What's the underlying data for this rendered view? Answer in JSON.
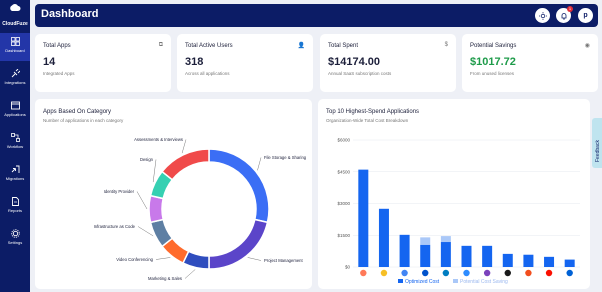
{
  "app": {
    "logo_text": "CloudFuze",
    "page_title": "Dashboard",
    "avatar_initial": "p",
    "notification_count": "1"
  },
  "sidebar": {
    "items": [
      {
        "label": "Dashboard",
        "icon": "grid-icon",
        "active": true
      },
      {
        "label": "Integrations",
        "icon": "plug-icon"
      },
      {
        "label": "Applications",
        "icon": "window-icon"
      },
      {
        "label": "Workflow",
        "icon": "workflow-icon"
      },
      {
        "label": "Migrations",
        "icon": "migrate-icon"
      },
      {
        "label": "Reports",
        "icon": "document-icon"
      },
      {
        "label": "Settings",
        "icon": "gear-icon"
      }
    ]
  },
  "stats": [
    {
      "label": "Total Apps",
      "value": "14",
      "sub": "Integrated Apps",
      "icon": "apps-icon"
    },
    {
      "label": "Total Active Users",
      "value": "318",
      "sub": "Across all applications",
      "icon": "users-icon"
    },
    {
      "label": "Total Spent",
      "value": "$14174.00",
      "sub": "Annual SaaS subscription costs",
      "icon": "dollar-icon"
    },
    {
      "label": "Potential Savings",
      "value": "$1017.72",
      "sub": "From unused licenses",
      "icon": "piggy-icon",
      "accent": "#1e9b4a"
    }
  ],
  "category_panel": {
    "title": "Apps Based On Category",
    "subtitle": "Number of applications in each category"
  },
  "spend_panel": {
    "title": "Top 10 Highest-Spend Applications",
    "subtitle": "Organization-Wide Total Cost Breakdown"
  },
  "feedback_label": "Feedback",
  "chart_data": [
    {
      "type": "pie",
      "title": "Apps Based On Category",
      "categories": [
        "File Storage & Sharing",
        "Project Management",
        "Marketing & Sales",
        "Video Conferencing",
        "Infrastructure as Code",
        "Identity Provider",
        "Design",
        "Assessments & Interviews"
      ],
      "values": [
        4,
        3,
        1,
        1,
        1,
        1,
        1,
        2
      ],
      "colors": [
        "#3b6ef5",
        "#5b45c9",
        "#2f4dbe",
        "#ff6b2c",
        "#5e7fa3",
        "#c879ea",
        "#36d0b2",
        "#f04a4a"
      ]
    },
    {
      "type": "bar",
      "title": "Top 10 Highest-Spend Applications",
      "ylim": [
        0,
        6000
      ],
      "yticks": [
        "$0",
        "$1500",
        "$3000",
        "$4500",
        "$6000"
      ],
      "categories": [
        "HubSpot",
        "Monday.com",
        "Google Workspace",
        "Atlassian",
        "Okta",
        "Zoom",
        "Terraform",
        "1Password",
        "Figma",
        "Adobe",
        "Box"
      ],
      "series": [
        {
          "name": "Optimized Cost",
          "values": [
            4600,
            2750,
            1520,
            1050,
            1180,
            1000,
            1000,
            620,
            580,
            480,
            350
          ],
          "color": "#1465f0"
        },
        {
          "name": "Potential Cost Saving",
          "values": [
            0,
            0,
            0,
            350,
            280,
            0,
            0,
            0,
            0,
            0,
            0
          ],
          "color": "#aac8f8"
        }
      ]
    }
  ]
}
